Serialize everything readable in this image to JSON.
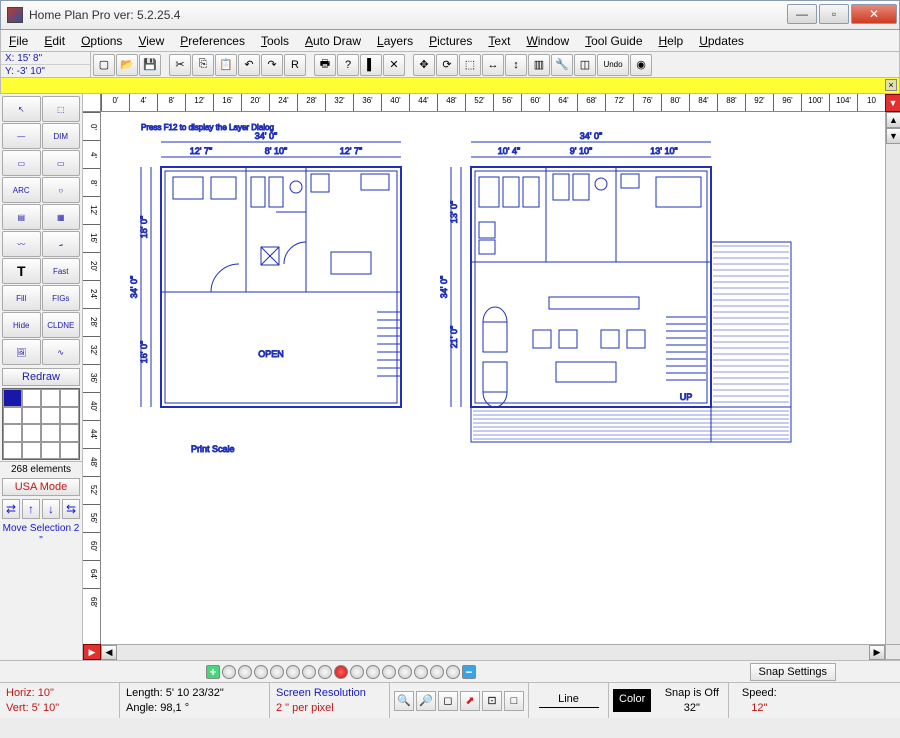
{
  "app": {
    "title": "Home Plan Pro ver: 5.2.25.4"
  },
  "menu": [
    "File",
    "Edit",
    "Options",
    "View",
    "Preferences",
    "Tools",
    "Auto Draw",
    "Layers",
    "Pictures",
    "Text",
    "Window",
    "Tool Guide",
    "Help",
    "Updates"
  ],
  "coords": {
    "x": "X: 15' 8\"",
    "y": "Y: -3' 10\""
  },
  "toolbar_icons": [
    "new",
    "open",
    "save",
    "cut",
    "copy",
    "paste",
    "undo",
    "redo",
    "rect-r",
    "print",
    "help-q",
    "door",
    "delete-x",
    "move",
    "refresh",
    "select-dash",
    "h-arrows",
    "v-arrows",
    "columns",
    "tools",
    "eraser",
    "undo2",
    "globe"
  ],
  "left_tools": [
    [
      "pointer",
      "select-box"
    ],
    [
      "line",
      "dim"
    ],
    [
      "rect-outline",
      "rect"
    ],
    [
      "arc",
      "circle"
    ],
    [
      "hatch",
      "grid3"
    ],
    [
      "curve",
      "angle"
    ],
    [
      "text-t",
      "fast-t"
    ],
    [
      "fill",
      "figs"
    ],
    [
      "hide",
      "cldne"
    ],
    [
      "image",
      "spline"
    ]
  ],
  "left_labels": {
    "dim": "DIM",
    "arc": "ARC",
    "fast": "Fast",
    "fill": "Fill",
    "figs": "FIGs",
    "hide": "Hide",
    "cldne": "CLDNE",
    "redraw": "Redraw",
    "elements": "268 elements",
    "usamode": "USA Mode",
    "movesel": "Move Selection 2 \""
  },
  "ruler_h": [
    "0'",
    "4'",
    "8'",
    "12'",
    "16'",
    "20'",
    "24'",
    "28'",
    "32'",
    "36'",
    "40'",
    "44'",
    "48'",
    "52'",
    "56'",
    "60'",
    "64'",
    "68'",
    "72'",
    "76'",
    "80'",
    "84'",
    "88'",
    "92'",
    "96'",
    "100'",
    "104'",
    "10"
  ],
  "ruler_v": [
    "0'",
    "4'",
    "8'",
    "12'",
    "16'",
    "20'",
    "24'",
    "28'",
    "32'",
    "36'",
    "40'",
    "44'",
    "48'",
    "52'",
    "56'",
    "60'",
    "64'",
    "68'"
  ],
  "plan": {
    "hint": "Press   F12   to display the Layer Dialog",
    "left": {
      "width": "34' 0\"",
      "cols": [
        "12' 7\"",
        "8' 10\"",
        "12' 7\""
      ],
      "height": "34' 0\"",
      "rows": [
        "18' 0\"",
        "16' 0\""
      ],
      "open": "OPEN",
      "printscale": "Print Scale"
    },
    "right": {
      "width": "34' 0\"",
      "cols": [
        "10' 4\"",
        "9' 10\"",
        "13' 10\""
      ],
      "height": "34' 0\"",
      "rows": [
        "13' 0\"",
        "21' 0\""
      ],
      "up": "UP"
    }
  },
  "snap": {
    "label": "Snap Settings"
  },
  "status": {
    "horiz": "Horiz: 10\"",
    "vert": "Vert: 5' 10\"",
    "length": "Length: 5' 10 23/32\"",
    "angle": "Angle:  98,1 °",
    "screenres": "Screen Resolution",
    "perpixel": "2 \" per pixel",
    "line": "Line",
    "color": "Color",
    "snap": "Snap is Off",
    "snapval": "32\"",
    "speed": "Speed:",
    "speedval": "12\""
  }
}
